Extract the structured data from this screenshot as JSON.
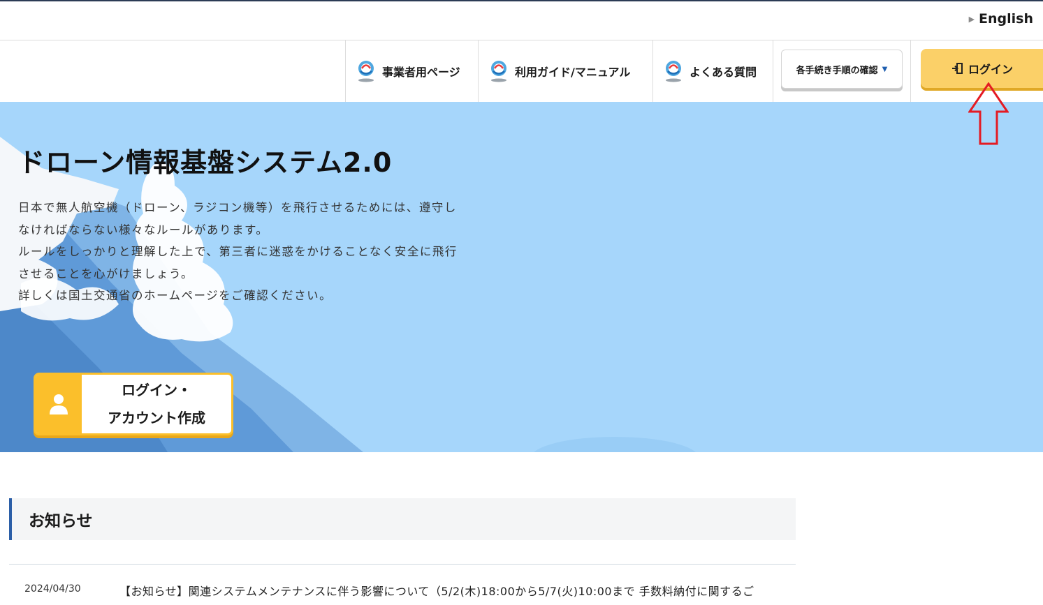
{
  "language": {
    "label": "English"
  },
  "nav": {
    "items": [
      {
        "label": "事業者用ページ"
      },
      {
        "label": "利用ガイド/マニュアル"
      },
      {
        "label": "よくある質問"
      }
    ],
    "procedure_dropdown": "各手続き手順の確認",
    "login": "ログイン"
  },
  "hero": {
    "title": "ドローン情報基盤システム2.0",
    "description": [
      "日本で無人航空機（ドローン、ラジコン機等）を飛行させるためには、遵守し",
      "なければならない様々なルールがあります。",
      "ルールをしっかりと理解した上で、第三者に迷惑をかけることなく安全に飛行",
      "させることを心がけましょう。",
      "詳しくは国土交通省のホームページをご確認ください。"
    ],
    "account_button": {
      "line1": "ログイン・",
      "line2": "アカウント作成"
    }
  },
  "notices": {
    "heading": "お知らせ",
    "items": [
      {
        "date": "2024/04/30",
        "text": "【お知らせ】関連システムメンテナンスに伴う影響について（5/2(木)18:00から5/7(火)10:00まで 手数料納付に関するご"
      }
    ]
  },
  "colors": {
    "hero_bg": "#a6d6fb",
    "accent_yellow": "#fbd068",
    "account_yellow": "#fbbf2b",
    "heading_bar": "#2b5ea7",
    "annotation_red": "#e41b23"
  },
  "icons": [
    "mlit-logo-icon",
    "caret-down-icon",
    "login-door-icon",
    "user-icon",
    "red-arrow-up"
  ]
}
